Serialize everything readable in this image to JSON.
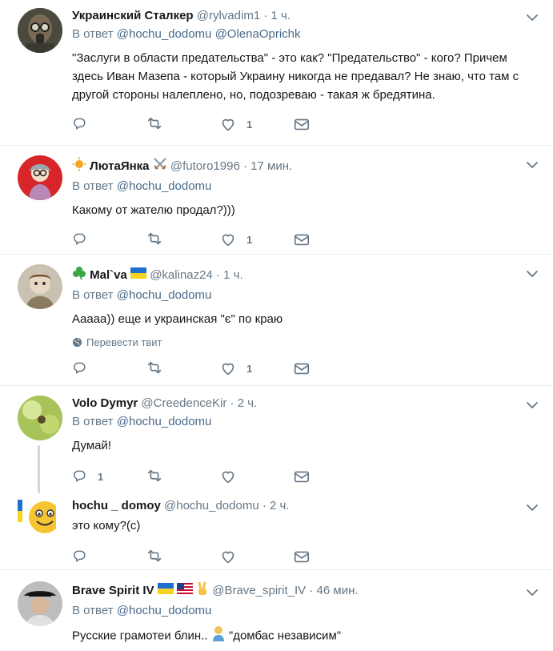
{
  "tweets": [
    {
      "name": "Украинский Сталкер",
      "handle": "@rylvadim1",
      "time": "1 ч.",
      "reply_prefix": "В ответ",
      "reply_to": "@hochu_dodomu @OlenaOprichk",
      "text": "\"Заслуги в области предательства\" - это как? \"Предательство\" - кого? Причем здесь Иван Мазепа - который Украину никогда не предавал? Не знаю, что там с другой стороны налеплено, но, подозреваю - такая ж бредятина.",
      "reply_count": "",
      "retweet_count": "",
      "like_count": "1"
    },
    {
      "name": "ЛютаЯнка",
      "handle": "@futoro1996",
      "time": "17 мин.",
      "reply_prefix": "В ответ",
      "reply_to": "@hochu_dodomu",
      "text": "Какому от жателю продал?)))",
      "reply_count": "",
      "retweet_count": "",
      "like_count": "1"
    },
    {
      "name": "Mal`va",
      "handle": "@kalinaz24",
      "time": "1 ч.",
      "reply_prefix": "В ответ",
      "reply_to": "@hochu_dodomu",
      "text": "Аaaaa)) еще и украинская \"є\" по краю",
      "translate": "Перевести твит",
      "reply_count": "",
      "retweet_count": "",
      "like_count": "1"
    },
    {
      "name": "Volo Dymyr",
      "handle": "@CreedenceKir",
      "time": "2 ч.",
      "reply_prefix": "В ответ",
      "reply_to": "@hochu_dodomu",
      "text": "Думай!",
      "reply_count": "1",
      "retweet_count": "",
      "like_count": ""
    },
    {
      "name": "hochu _ domoy",
      "handle": "@hochu_dodomu",
      "time": "2 ч.",
      "text": "это кому?(с)",
      "reply_count": "",
      "retweet_count": "",
      "like_count": ""
    },
    {
      "name": "Brave Spirit IV",
      "handle": "@Brave_spirit_IV",
      "time": "46 мин.",
      "reply_prefix": "В ответ",
      "reply_to": "@hochu_dodomu",
      "text_before": "Русские грамотеи блин..",
      "text_after": "\"домбас независим\""
    }
  ],
  "separator": "·",
  "colors": {
    "muted": "#657786",
    "link": "#4a6b8a",
    "border": "#e6ecf0"
  }
}
